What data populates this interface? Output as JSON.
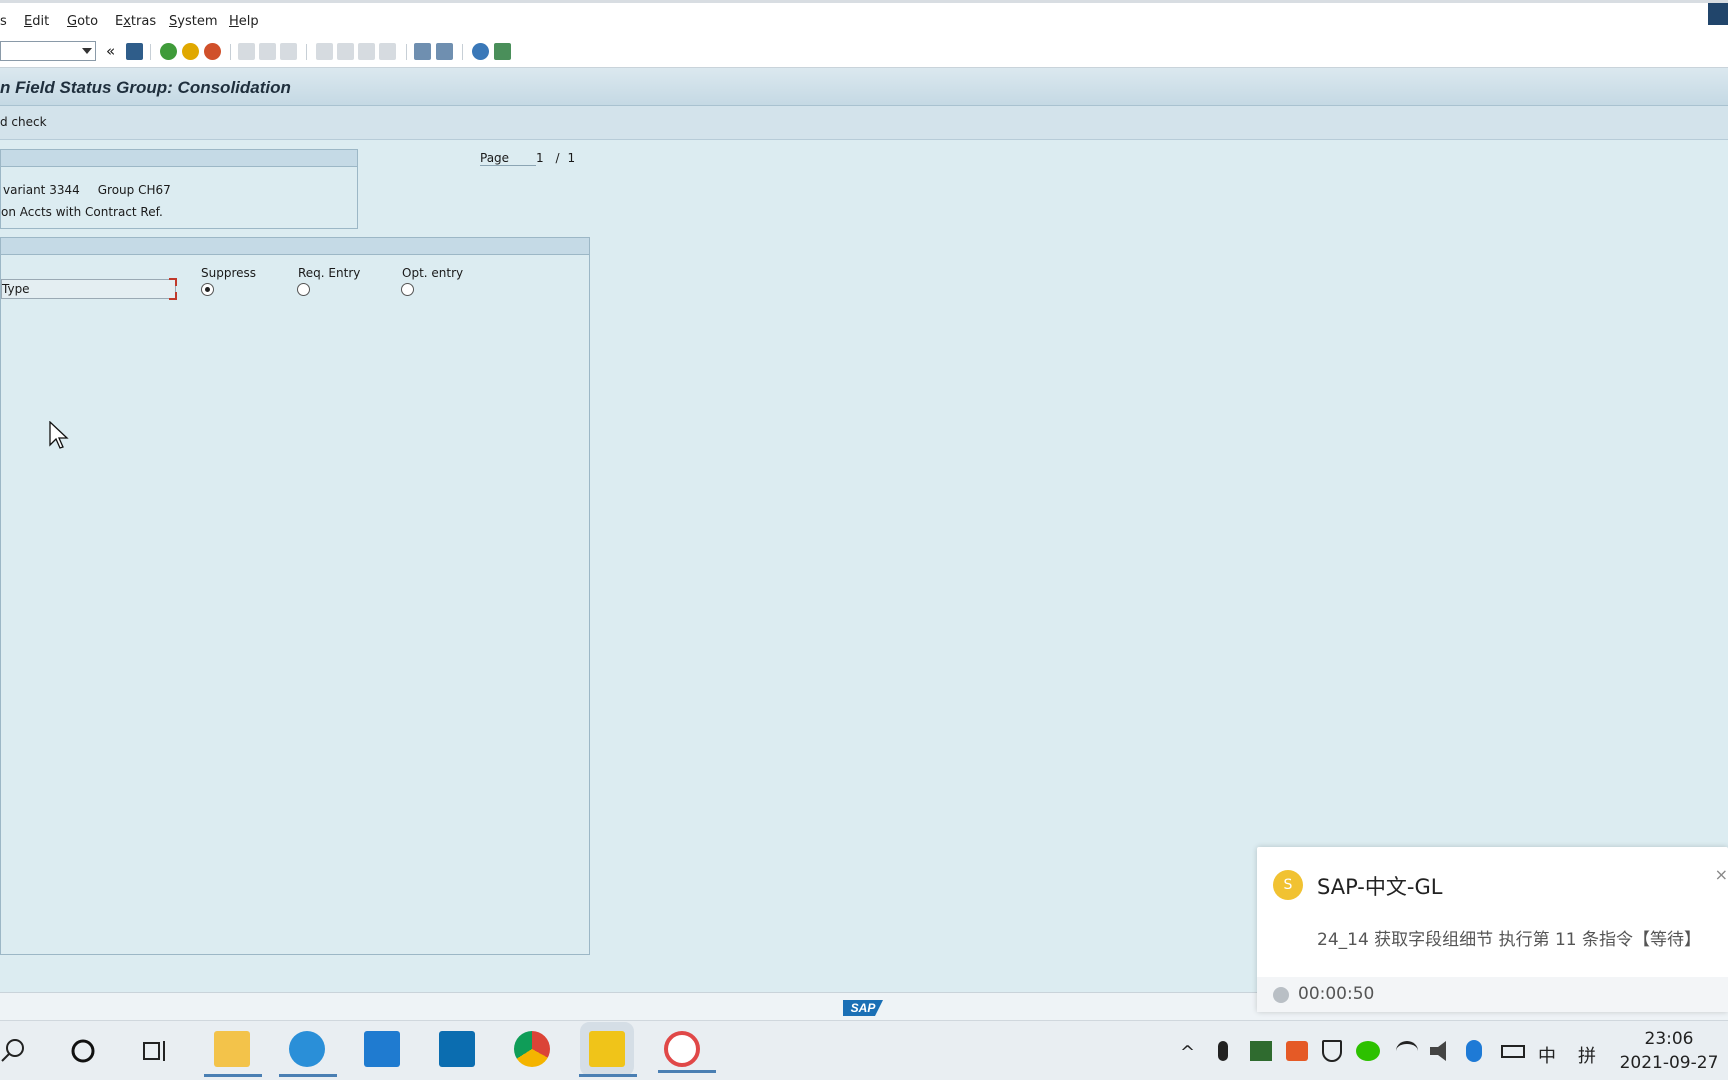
{
  "menu": {
    "items": [
      "s",
      "Edit",
      "Goto",
      "Extras",
      "System",
      "Help"
    ],
    "underline": [
      "s",
      "E",
      "G",
      "x",
      "S",
      "H"
    ]
  },
  "title": "n Field Status Group: Consolidation",
  "app_toolbar": {
    "button_label": "d check"
  },
  "header_box": {
    "variant_text": "variant 3344",
    "group_text": "Group CH67",
    "description": "on Accts with Contract Ref."
  },
  "page_indicator": {
    "label": "Page",
    "current": "1",
    "separator": "/",
    "total": "1"
  },
  "field_status": {
    "columns": [
      "Suppress",
      "Req. Entry",
      "Opt. entry"
    ],
    "rows": [
      {
        "field": "Type",
        "selected": "Suppress"
      }
    ]
  },
  "status_bar": {
    "logo": "SAP"
  },
  "notification": {
    "avatar_letter": "S",
    "title": "SAP-中文-GL",
    "body": "24_14 获取字段组细节 执行第 11 条指令【等待】",
    "elapsed": "00:00:50",
    "close": "×"
  },
  "taskbar": {
    "tray": {
      "ime_lang": "中",
      "ime_mode": "拼",
      "chevron": "^"
    },
    "clock": {
      "time": "23:06",
      "date": "2021-09-27"
    }
  },
  "colors": {
    "sap_blue": "#1a6fb5",
    "work_bg": "#dcecf1",
    "title_bg": "#c5d9e4",
    "avatar": "#f1c232"
  }
}
